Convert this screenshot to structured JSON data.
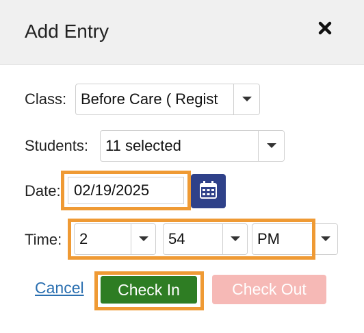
{
  "dialog": {
    "title": "Add Entry",
    "close_icon": "close-x-icon"
  },
  "form": {
    "class_label": "Class:",
    "class_value": "Before Care ( Regist",
    "students_label": "Students:",
    "students_value": "11 selected",
    "date_label": "Date:",
    "date_value": "02/19/2025",
    "calendar_icon": "calendar-icon",
    "time_label": "Time:",
    "time_hour": "2",
    "time_minute": "54",
    "time_ampm": "PM"
  },
  "actions": {
    "cancel_label": "Cancel",
    "check_in_label": "Check In",
    "check_out_label": "Check Out"
  },
  "colors": {
    "highlight": "#ef9a34",
    "check_in_bg": "#2e7d23",
    "check_out_bg": "#f6b9b6",
    "calendar_bg": "#2f4189",
    "link": "#2a6fb0"
  }
}
